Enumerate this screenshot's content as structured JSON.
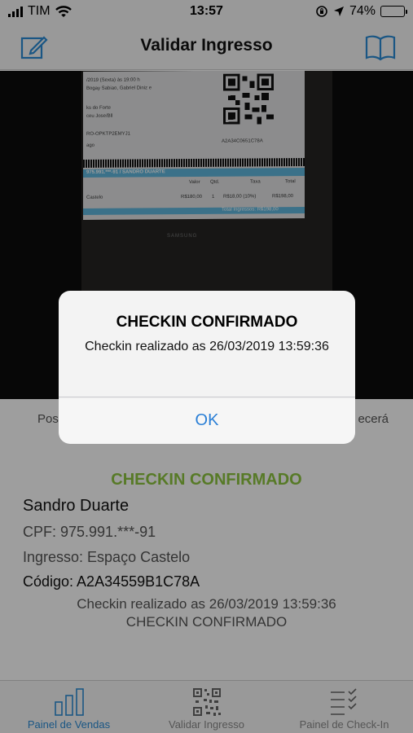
{
  "status_bar": {
    "carrier": "TIM",
    "time": "13:57",
    "battery": "74%",
    "battery_level": 0.74
  },
  "nav": {
    "title": "Validar Ingresso",
    "left_icon": "edit-icon",
    "right_icon": "book-icon"
  },
  "camera_view": {
    "ticket_lines": [
      "/2019 (Sexta) às 19:00 h",
      "Bogay Sabiao, Gabriel Diniz e",
      "ks do Forte",
      "ceu Jose/Bll",
      "RO-OPKTP2EMYJ1",
      "ago"
    ],
    "ticket_code": "A2A34C0651C78A",
    "ticket_holder": "975.991.***-91 / SANDRO DUARTE",
    "ticket_cols": [
      "Valor",
      "Qtd.",
      "Taxa",
      "Total"
    ],
    "ticket_row": [
      "R$180,00",
      "1",
      "R$18,00 (10%)",
      "R$198,00"
    ],
    "ticket_total": "Total Ingressos: R$198,00",
    "ticket_item": "Castelo",
    "monitor_brand": "SAMSUNG"
  },
  "content": {
    "hint_left": "Pos",
    "hint_right": "ecerá",
    "status_title": "CHECKIN CONFIRMADO",
    "person_name": "Sandro Duarte",
    "cpf": "CPF: 975.991.***-91",
    "ticket_type": "Ingresso: Espaço Castelo",
    "code": "Código: A2A34559B1C78A",
    "log_line1": "Checkin realizado as 26/03/2019 13:59:36",
    "log_line2": "CHECKIN CONFIRMADO"
  },
  "alert": {
    "title": "CHECKIN CONFIRMADO",
    "message": "Checkin realizado as 26/03/2019 13:59:36",
    "button": "OK"
  },
  "tabs": [
    {
      "label": "Painel de Vendas",
      "icon": "bar-chart-icon",
      "active": true
    },
    {
      "label": "Validar Ingresso",
      "icon": "qr-code-icon",
      "active": false
    },
    {
      "label": "Painel de Check-In",
      "icon": "checklist-icon",
      "active": false
    }
  ],
  "colors": {
    "accent": "#2a8cd6",
    "success": "#8dc63f",
    "ticket_blue": "#5fb7dd"
  }
}
